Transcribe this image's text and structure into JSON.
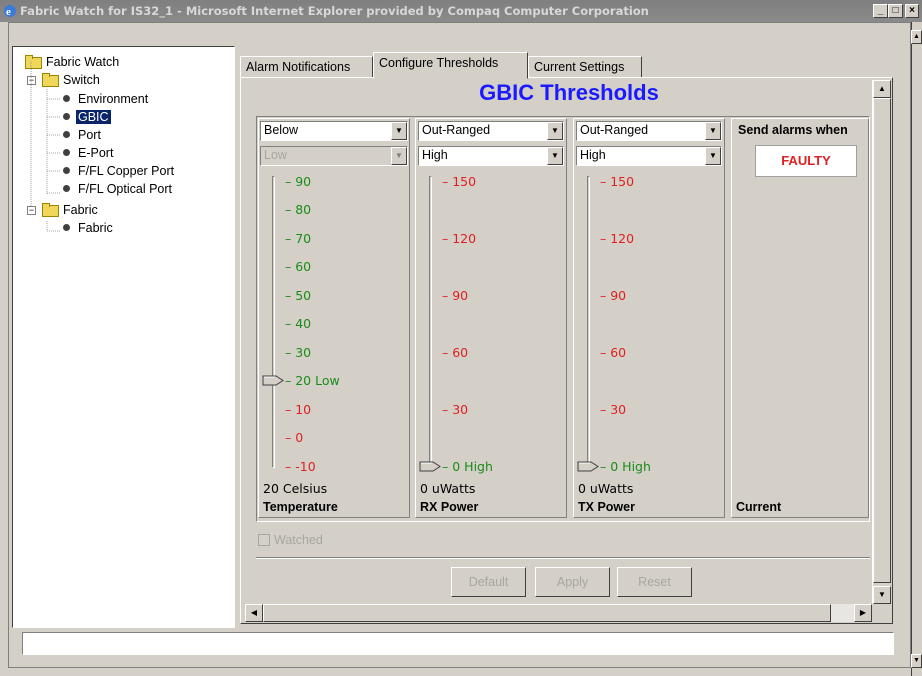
{
  "window": {
    "title": "Fabric Watch for IS32_1 - Microsoft Internet Explorer provided by Compaq Computer Corporation",
    "minimize": "_",
    "maximize": "□",
    "close": "×"
  },
  "tree": {
    "root": "Fabric Watch",
    "switch": "Switch",
    "switch_items": [
      "Environment",
      "GBIC",
      "Port",
      "E-Port",
      "F/FL Copper Port",
      "F/FL Optical Port"
    ],
    "selected": "GBIC",
    "fabric": "Fabric",
    "fabric_items": [
      "Fabric"
    ]
  },
  "tabs": [
    "Alarm Notifications",
    "Configure Thresholds",
    "Current Settings"
  ],
  "active_tab": "Configure Thresholds",
  "heading": "GBIC Thresholds",
  "columns": [
    {
      "mode": "Below",
      "level": "Low",
      "level_disabled": true,
      "ticks": [
        "90",
        "80",
        "70",
        "60",
        "50",
        "40",
        "30",
        "20",
        "10",
        "0",
        "-10"
      ],
      "tick_colors": [
        "green",
        "green",
        "green",
        "green",
        "green",
        "green",
        "green",
        "green",
        "red",
        "red",
        "red"
      ],
      "marker_tick": "20",
      "marker_label": "Low",
      "readout": "20 Celsius",
      "name": "Temperature"
    },
    {
      "mode": "Out-Ranged",
      "level": "High",
      "level_disabled": false,
      "ticks": [
        "150",
        "120",
        "90",
        "60",
        "30",
        "0"
      ],
      "tick_colors": [
        "red",
        "red",
        "red",
        "red",
        "red",
        "green"
      ],
      "marker_tick": "0",
      "marker_label": "High",
      "readout": "0 uWatts",
      "name": "RX Power"
    },
    {
      "mode": "Out-Ranged",
      "level": "High",
      "level_disabled": false,
      "ticks": [
        "150",
        "120",
        "90",
        "60",
        "30",
        "0"
      ],
      "tick_colors": [
        "red",
        "red",
        "red",
        "red",
        "red",
        "green"
      ],
      "marker_tick": "0",
      "marker_label": "High",
      "readout": "0 uWatts",
      "name": "TX Power"
    }
  ],
  "alarm": {
    "label": "Send alarms when",
    "state": "FAULTY",
    "name": "Current"
  },
  "watched_label": "Watched",
  "buttons": {
    "default": "Default",
    "apply": "Apply",
    "reset": "Reset"
  },
  "colors": {
    "heading": "#1a1aff",
    "green": "#1a8c1a",
    "red": "#e02020",
    "selection": "#0a246a"
  }
}
